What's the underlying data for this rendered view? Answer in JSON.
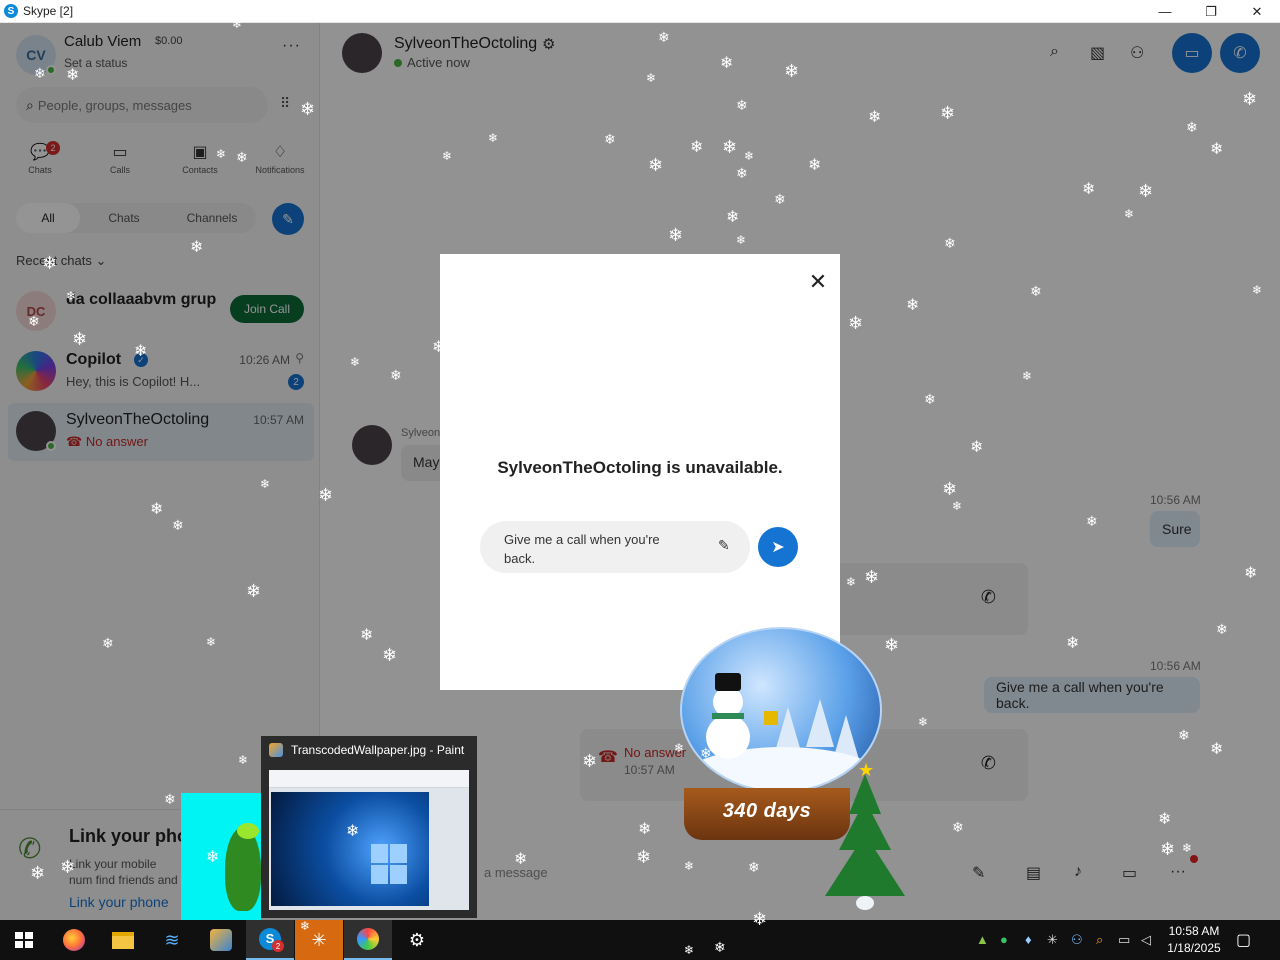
{
  "window": {
    "title": "Skype [2]",
    "app_icon": "S",
    "minimize": "—",
    "restore": "❐",
    "close": "✕"
  },
  "profile": {
    "initials": "CV",
    "name": "Calub Viem",
    "credit": "$0.00",
    "status": "Set a status",
    "more": "···"
  },
  "search": {
    "placeholder": "People, groups, messages",
    "icon": "search-icon",
    "dialpad_icon": "dialpad-icon"
  },
  "nav": [
    {
      "label": "Chats",
      "icon": "chat-icon",
      "badge": "2"
    },
    {
      "label": "Calls",
      "icon": "video-icon"
    },
    {
      "label": "Contacts",
      "icon": "contacts-icon"
    },
    {
      "label": "Notifications",
      "icon": "bell-icon"
    }
  ],
  "filters": [
    "All",
    "Chats",
    "Channels"
  ],
  "recent_label": "Recent chats ⌄",
  "chats": [
    {
      "initials": "DC",
      "name": "da collaaabvm grup",
      "action": "Join Call"
    },
    {
      "name": "Copilot",
      "time": "10:26 AM",
      "preview": "Hey, this is Copilot! H...",
      "unread": "2"
    },
    {
      "name": "SylveonTheOctoling",
      "time": "10:57 AM",
      "preview": "No answer"
    }
  ],
  "link_phone": {
    "title": "Link your pho",
    "body": "Link your mobile num find friends and mak",
    "link": "Link your phone"
  },
  "conversation": {
    "name": "SylveonTheOctoling",
    "status": "Active now",
    "sender_label": "Sylveon",
    "message_fragment": "May",
    "time1": "10:56 AM",
    "reply1": "Sure",
    "time2": "10:56 AM",
    "reply2": "Give me a call when you're back.",
    "missed_call": "No answer",
    "missed_time": "10:57 AM",
    "composer_placeholder": "a message"
  },
  "modal": {
    "message": "SylveonTheOctoling is unavailable.",
    "input_value": "Give me a call when you're back.",
    "close": "✕"
  },
  "globe": {
    "caption": "340 days"
  },
  "preview": {
    "title": "TranscodedWallpaper.jpg - Paint"
  },
  "taskbar": {
    "time": "10:58 AM",
    "date": "1/18/2025",
    "skype_badge": "2"
  },
  "colors": {
    "accent": "#1573d1",
    "join_call": "#0e6b37",
    "missed": "#c62828"
  }
}
